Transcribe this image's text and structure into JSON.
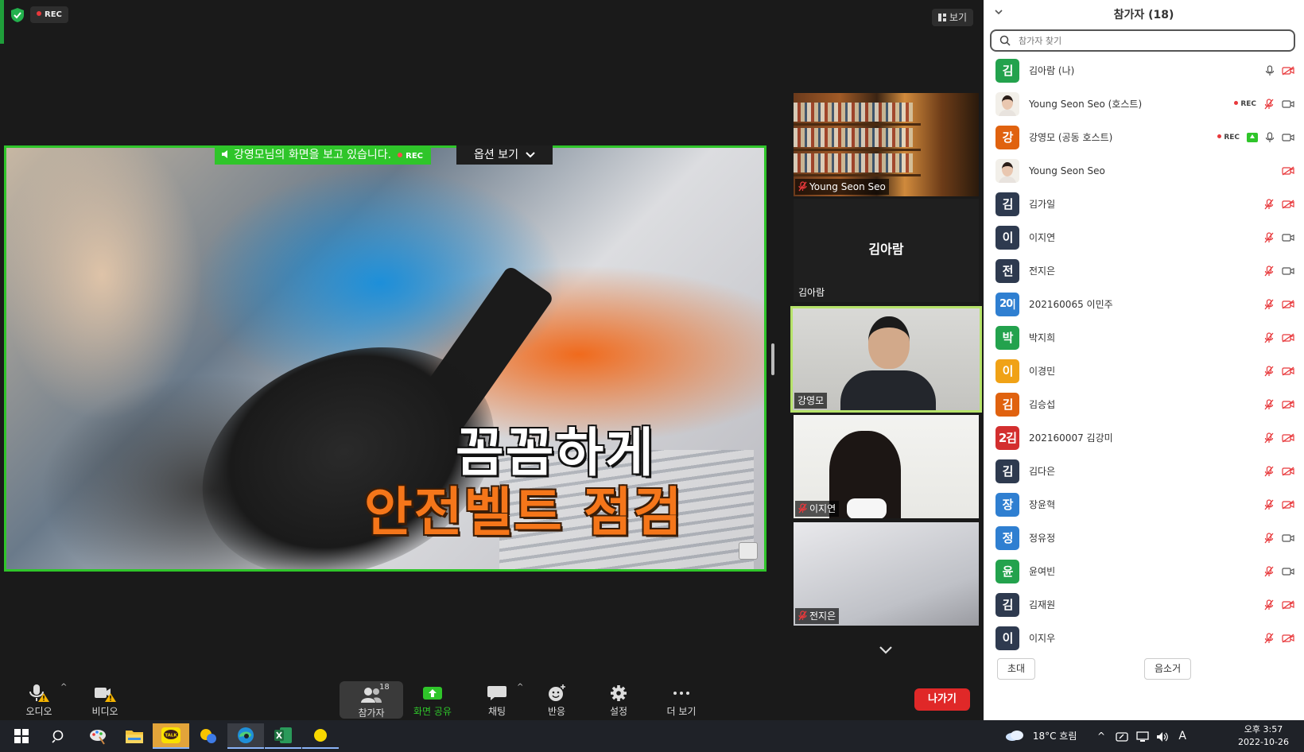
{
  "meeting": {
    "rec_label": "REC",
    "view_label": "보기",
    "viewing_text": "강영모님의 화면을 보고 있습니다.",
    "viewing_rec": "REC",
    "options_label": "옵션 보기",
    "shared_caption_line1": "꼼꼼하게",
    "shared_caption_line2": "안전벨트 점검"
  },
  "tiles": [
    {
      "name": "Young Seon Seo",
      "muted": true
    },
    {
      "name": "김아람",
      "center_label": "김아람",
      "muted": false
    },
    {
      "name": "강영모",
      "muted": false,
      "active_speaker": true
    },
    {
      "name": "이지연",
      "muted": true
    },
    {
      "name": "전지은",
      "muted": true
    }
  ],
  "toolbar": {
    "audio": "오디오",
    "video": "비디오",
    "participants": "참가자",
    "participants_count": "18",
    "share": "화면 공유",
    "chat": "채팅",
    "reactions": "반응",
    "settings": "설정",
    "more": "더 보기",
    "leave": "나가기"
  },
  "panel": {
    "title": "참가자 (18)",
    "search_placeholder": "참가자 찾기",
    "invite": "초대",
    "mute_all": "음소거",
    "participants": [
      {
        "avatar": "김",
        "color": "#23a24d",
        "name": "김아람 (나)",
        "rec": false,
        "share": false,
        "mic": "on",
        "video": "off"
      },
      {
        "avatar": "",
        "photo": true,
        "name": "Young Seon Seo (호스트)",
        "rec": true,
        "share": false,
        "mic": "muted",
        "video": "on"
      },
      {
        "avatar": "강",
        "color": "#e0620f",
        "name": "강영모 (공동 호스트)",
        "rec": true,
        "share": true,
        "mic": "on",
        "video": "on"
      },
      {
        "avatar": "",
        "photo": true,
        "name": "Young Seon Seo",
        "rec": false,
        "share": false,
        "mic": "none",
        "video": "off"
      },
      {
        "avatar": "김",
        "color": "#2e3a4f",
        "name": "김가일",
        "rec": false,
        "share": false,
        "mic": "muted",
        "video": "off"
      },
      {
        "avatar": "이",
        "color": "#2e3a4f",
        "name": "이지연",
        "rec": false,
        "share": false,
        "mic": "muted",
        "video": "on"
      },
      {
        "avatar": "전",
        "color": "#2e3a4f",
        "name": "전지은",
        "rec": false,
        "share": false,
        "mic": "muted",
        "video": "on"
      },
      {
        "avatar": "20|",
        "color": "#2f7fd1",
        "name": "202160065 이민주",
        "rec": false,
        "share": false,
        "mic": "muted",
        "video": "off"
      },
      {
        "avatar": "박",
        "color": "#23a24d",
        "name": "박지희",
        "rec": false,
        "share": false,
        "mic": "muted",
        "video": "off"
      },
      {
        "avatar": "이",
        "color": "#f0a216",
        "name": "이경민",
        "rec": false,
        "share": false,
        "mic": "muted",
        "video": "off"
      },
      {
        "avatar": "김",
        "color": "#e0620f",
        "name": "김승섭",
        "rec": false,
        "share": false,
        "mic": "muted",
        "video": "off"
      },
      {
        "avatar": "2김",
        "color": "#d32f2f",
        "name": "202160007 김강미",
        "rec": false,
        "share": false,
        "mic": "muted",
        "video": "off"
      },
      {
        "avatar": "김",
        "color": "#2e3a4f",
        "name": "김다은",
        "rec": false,
        "share": false,
        "mic": "muted",
        "video": "off"
      },
      {
        "avatar": "장",
        "color": "#2f7fd1",
        "name": "장윤혁",
        "rec": false,
        "share": false,
        "mic": "muted",
        "video": "off"
      },
      {
        "avatar": "정",
        "color": "#2f7fd1",
        "name": "정유정",
        "rec": false,
        "share": false,
        "mic": "muted",
        "video": "on"
      },
      {
        "avatar": "윤",
        "color": "#23a24d",
        "name": "윤여빈",
        "rec": false,
        "share": false,
        "mic": "muted",
        "video": "on"
      },
      {
        "avatar": "김",
        "color": "#2e3a4f",
        "name": "김재원",
        "rec": false,
        "share": false,
        "mic": "muted",
        "video": "off"
      },
      {
        "avatar": "이",
        "color": "#2e3a4f",
        "name": "이지우",
        "rec": false,
        "share": false,
        "mic": "muted",
        "video": "off"
      }
    ]
  },
  "taskbar": {
    "weather": "18°C 흐림",
    "ime": "A",
    "time": "오후 3:57",
    "date": "2022-10-26"
  },
  "colors": {
    "share_border": "#2fc52a",
    "active_speaker": "#b6e36a",
    "leave": "#e02828",
    "rec": "#e8383b",
    "muted_icon": "#e8383b"
  }
}
